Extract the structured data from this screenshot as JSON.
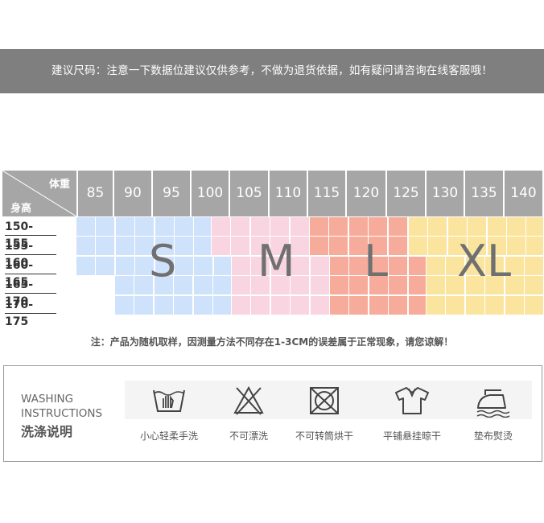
{
  "banner": {
    "text": "建议尺码：注意一下数据位建议仅供参考，不做为退货依据，如有疑问请咨询在线客服哦！"
  },
  "size_chart": {
    "weight_label": "体重",
    "height_label": "身高",
    "weights": [
      "85",
      "90",
      "95",
      "100",
      "105",
      "110",
      "115",
      "120",
      "125",
      "130",
      "135",
      "140"
    ],
    "heights": [
      "150-155",
      "155-160",
      "160-165",
      "165-170",
      "170-175"
    ],
    "sizes": [
      {
        "label": "S",
        "color": "#cfe2fb"
      },
      {
        "label": "M",
        "color": "#f9d4e1"
      },
      {
        "label": "L",
        "color": "#f7ab9a"
      },
      {
        "label": "XL",
        "color": "#fbe59e"
      }
    ]
  },
  "note": {
    "text": "注：产品为随机取样，因测量方法不同存在1-3CM的误差属于正常现象，请您谅解！"
  },
  "washing": {
    "title_en_line1": "WASHING",
    "title_en_line2": "INSTRUCTIONS",
    "title_cn": "洗涤说明",
    "items": [
      {
        "icon": "hand-wash-icon",
        "label": "小心轻柔手洗"
      },
      {
        "icon": "no-bleach-icon",
        "label": "不可漂洗"
      },
      {
        "icon": "no-tumble-dry-icon",
        "label": "不可转筒烘干"
      },
      {
        "icon": "flat-dry-icon",
        "label": "平铺悬挂晾干"
      },
      {
        "icon": "iron-icon",
        "label": "垫布熨烫"
      }
    ]
  }
}
